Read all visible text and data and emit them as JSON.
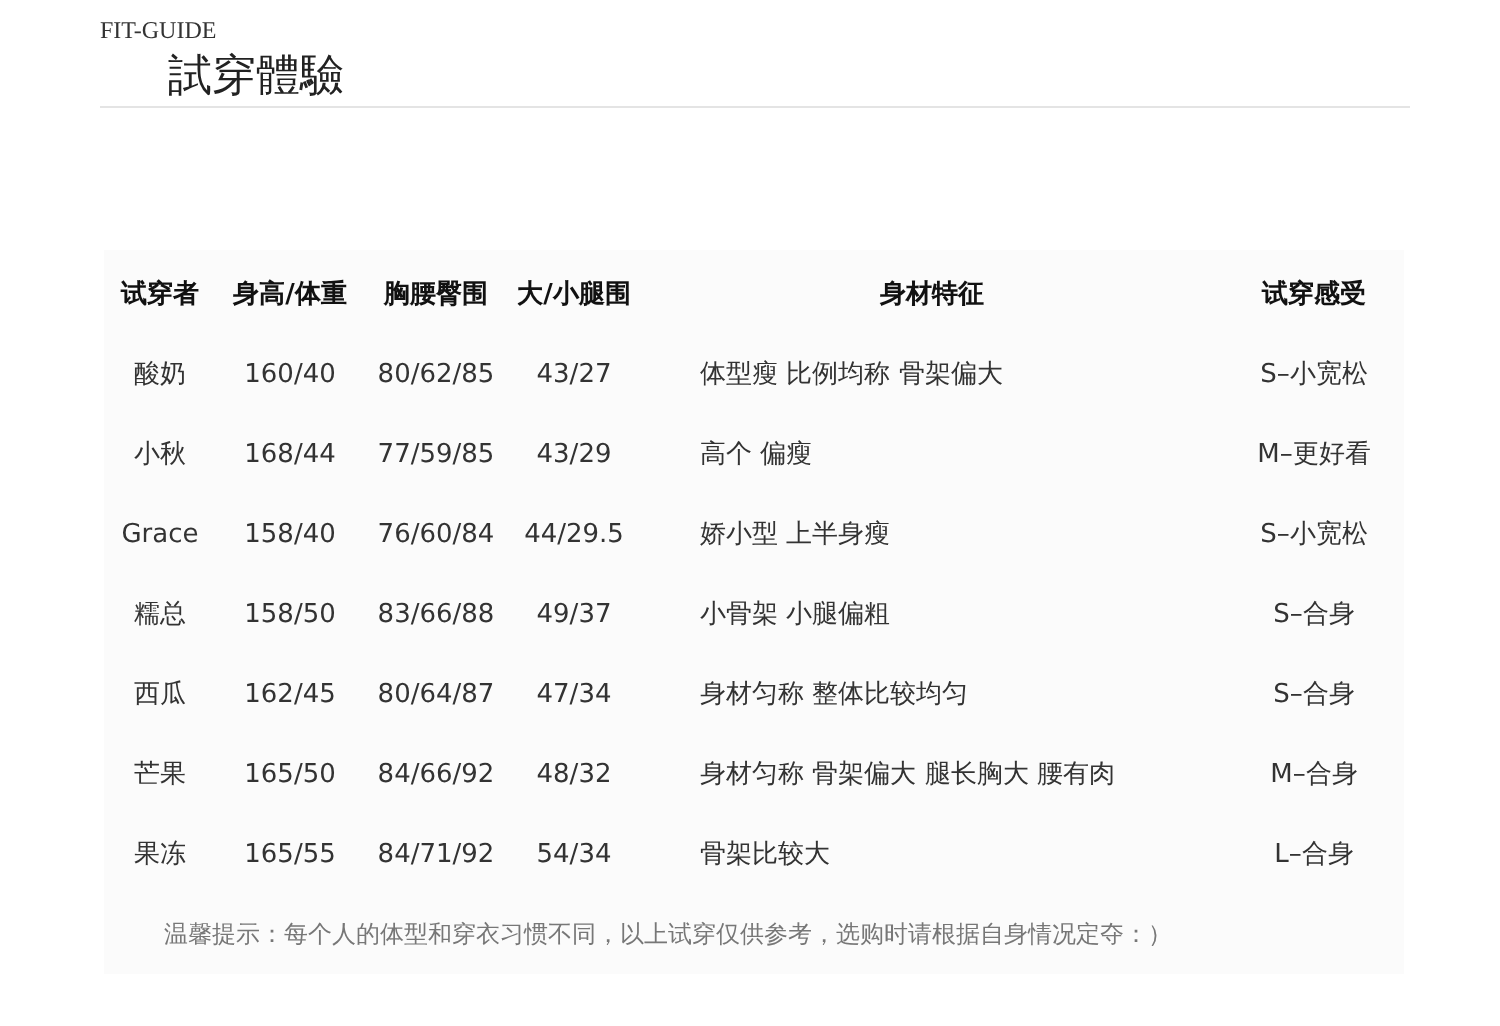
{
  "header": {
    "label": "FIT-GUIDE",
    "title": "試穿體驗"
  },
  "table": {
    "columns": [
      "试穿者",
      "身高/体重",
      "胸腰臀围",
      "大/小腿围",
      "身材特征",
      "试穿感受"
    ],
    "rows": [
      [
        "酸奶",
        "160/40",
        "80/62/85",
        "43/27",
        "体型瘦 比例均称 骨架偏大",
        "S–小宽松"
      ],
      [
        "小秋",
        "168/44",
        "77/59/85",
        "43/29",
        "高个 偏瘦",
        "M–更好看"
      ],
      [
        "Grace",
        "158/40",
        "76/60/84",
        "44/29.5",
        "娇小型 上半身瘦",
        "S–小宽松"
      ],
      [
        "糯总",
        "158/50",
        "83/66/88",
        "49/37",
        "小骨架 小腿偏粗",
        "S–合身"
      ],
      [
        "西瓜",
        "162/45",
        "80/64/87",
        "47/34",
        "身材匀称 整体比较均匀",
        "S–合身"
      ],
      [
        "芒果",
        "165/50",
        "84/66/92",
        "48/32",
        "身材匀称 骨架偏大 腿长胸大 腰有肉",
        "M–合身"
      ],
      [
        "果冻",
        "165/55",
        "84/71/92",
        "54/34",
        "骨架比较大",
        "L–合身"
      ]
    ]
  },
  "note": "温馨提示：每个人的体型和穿衣习惯不同，以上试穿仅供参考，选购时请根据自身情况定夺：）"
}
